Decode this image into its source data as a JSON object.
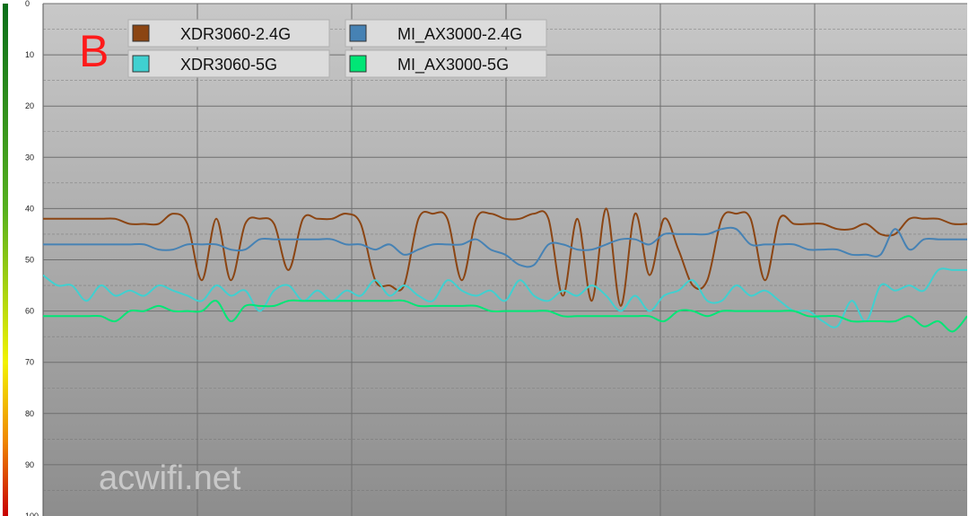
{
  "chart_data": {
    "type": "line",
    "panel_label": "B",
    "watermark": "acwifi.net",
    "ylim": [
      0,
      100
    ],
    "y_inverted": true,
    "y_ticks": [
      "0",
      "10",
      "20",
      "30",
      "40",
      "50",
      "60",
      "70",
      "80",
      "90",
      "100"
    ],
    "grid": true,
    "legend_position": "top-left",
    "colors": {
      "background_top": "#c8c8c8",
      "background_bottom": "#8d8d8d",
      "grid": "#6f6f6f",
      "scale_top": "#0a6e1a",
      "scale_mid_green": "#56b01e",
      "scale_yellow": "#f2f200",
      "scale_orange": "#f08a00",
      "scale_bottom": "#c80000"
    },
    "x": [
      0,
      2,
      4,
      6,
      8,
      10,
      12,
      14,
      16,
      18,
      20,
      22,
      24,
      26,
      28,
      30,
      32,
      34,
      36,
      38,
      40,
      42,
      44,
      46,
      48,
      50,
      52,
      54,
      56,
      58,
      60,
      62,
      64,
      66,
      68,
      70,
      72,
      74,
      76,
      78,
      80,
      82,
      84,
      86,
      88,
      90,
      92,
      94,
      96,
      98,
      100
    ],
    "series": [
      {
        "name": "XDR3060-2.4G",
        "color": "#8b4513",
        "values": [
          42,
          42,
          42,
          42,
          42,
          42,
          43,
          43,
          43,
          41,
          43,
          54,
          42,
          54,
          43,
          42,
          43,
          52,
          42,
          42,
          42,
          41,
          43,
          54,
          55,
          55,
          42,
          41,
          42,
          54,
          42,
          41,
          42,
          42,
          41,
          42,
          57,
          42,
          58,
          40,
          59,
          41,
          53,
          42,
          48,
          55,
          54,
          42,
          41,
          42,
          54,
          42,
          43,
          43,
          43,
          44,
          44,
          43,
          45,
          45,
          42,
          42,
          42,
          43,
          43
        ]
      },
      {
        "name": "MI_AX3000-2.4G",
        "color": "#4682b4",
        "values": [
          47,
          47,
          47,
          47,
          47,
          47,
          47,
          47,
          48,
          48,
          47,
          47,
          47,
          48,
          48,
          46,
          46,
          46,
          46,
          46,
          46,
          47,
          47,
          48,
          47,
          49,
          48,
          47,
          47,
          47,
          46,
          48,
          49,
          51,
          51,
          47,
          47,
          48,
          48,
          47,
          46,
          46,
          47,
          45,
          45,
          45,
          45,
          44,
          44,
          47,
          47,
          47,
          47,
          48,
          48,
          48,
          49,
          49,
          49,
          44,
          48,
          46,
          46,
          46,
          46
        ]
      },
      {
        "name": "XDR3060-5G",
        "color": "#40d0d0",
        "values": [
          53,
          55,
          55,
          58,
          55,
          57,
          56,
          57,
          55,
          56,
          57,
          58,
          55,
          57,
          56,
          60,
          56,
          55,
          58,
          56,
          58,
          56,
          57,
          54,
          57,
          55,
          57,
          58,
          54,
          56,
          57,
          56,
          58,
          54,
          57,
          58,
          56,
          57,
          55,
          57,
          60,
          57,
          60,
          57,
          56,
          54,
          58,
          58,
          55,
          57,
          56,
          58,
          60,
          60,
          62,
          63,
          58,
          62,
          55,
          56,
          55,
          56,
          52,
          52,
          52
        ]
      },
      {
        "name": "MI_AX3000-5G",
        "color": "#00e676",
        "values": [
          61,
          61,
          61,
          61,
          61,
          62,
          60,
          60,
          59,
          60,
          60,
          60,
          58,
          62,
          59,
          59,
          59,
          58,
          58,
          58,
          58,
          58,
          58,
          58,
          58,
          58,
          59,
          59,
          59,
          59,
          59,
          60,
          60,
          60,
          60,
          60,
          61,
          61,
          61,
          61,
          61,
          61,
          61,
          62,
          60,
          60,
          61,
          60,
          60,
          60,
          60,
          60,
          60,
          61,
          61,
          61,
          62,
          62,
          62,
          62,
          61,
          63,
          62,
          64,
          61
        ]
      }
    ]
  }
}
